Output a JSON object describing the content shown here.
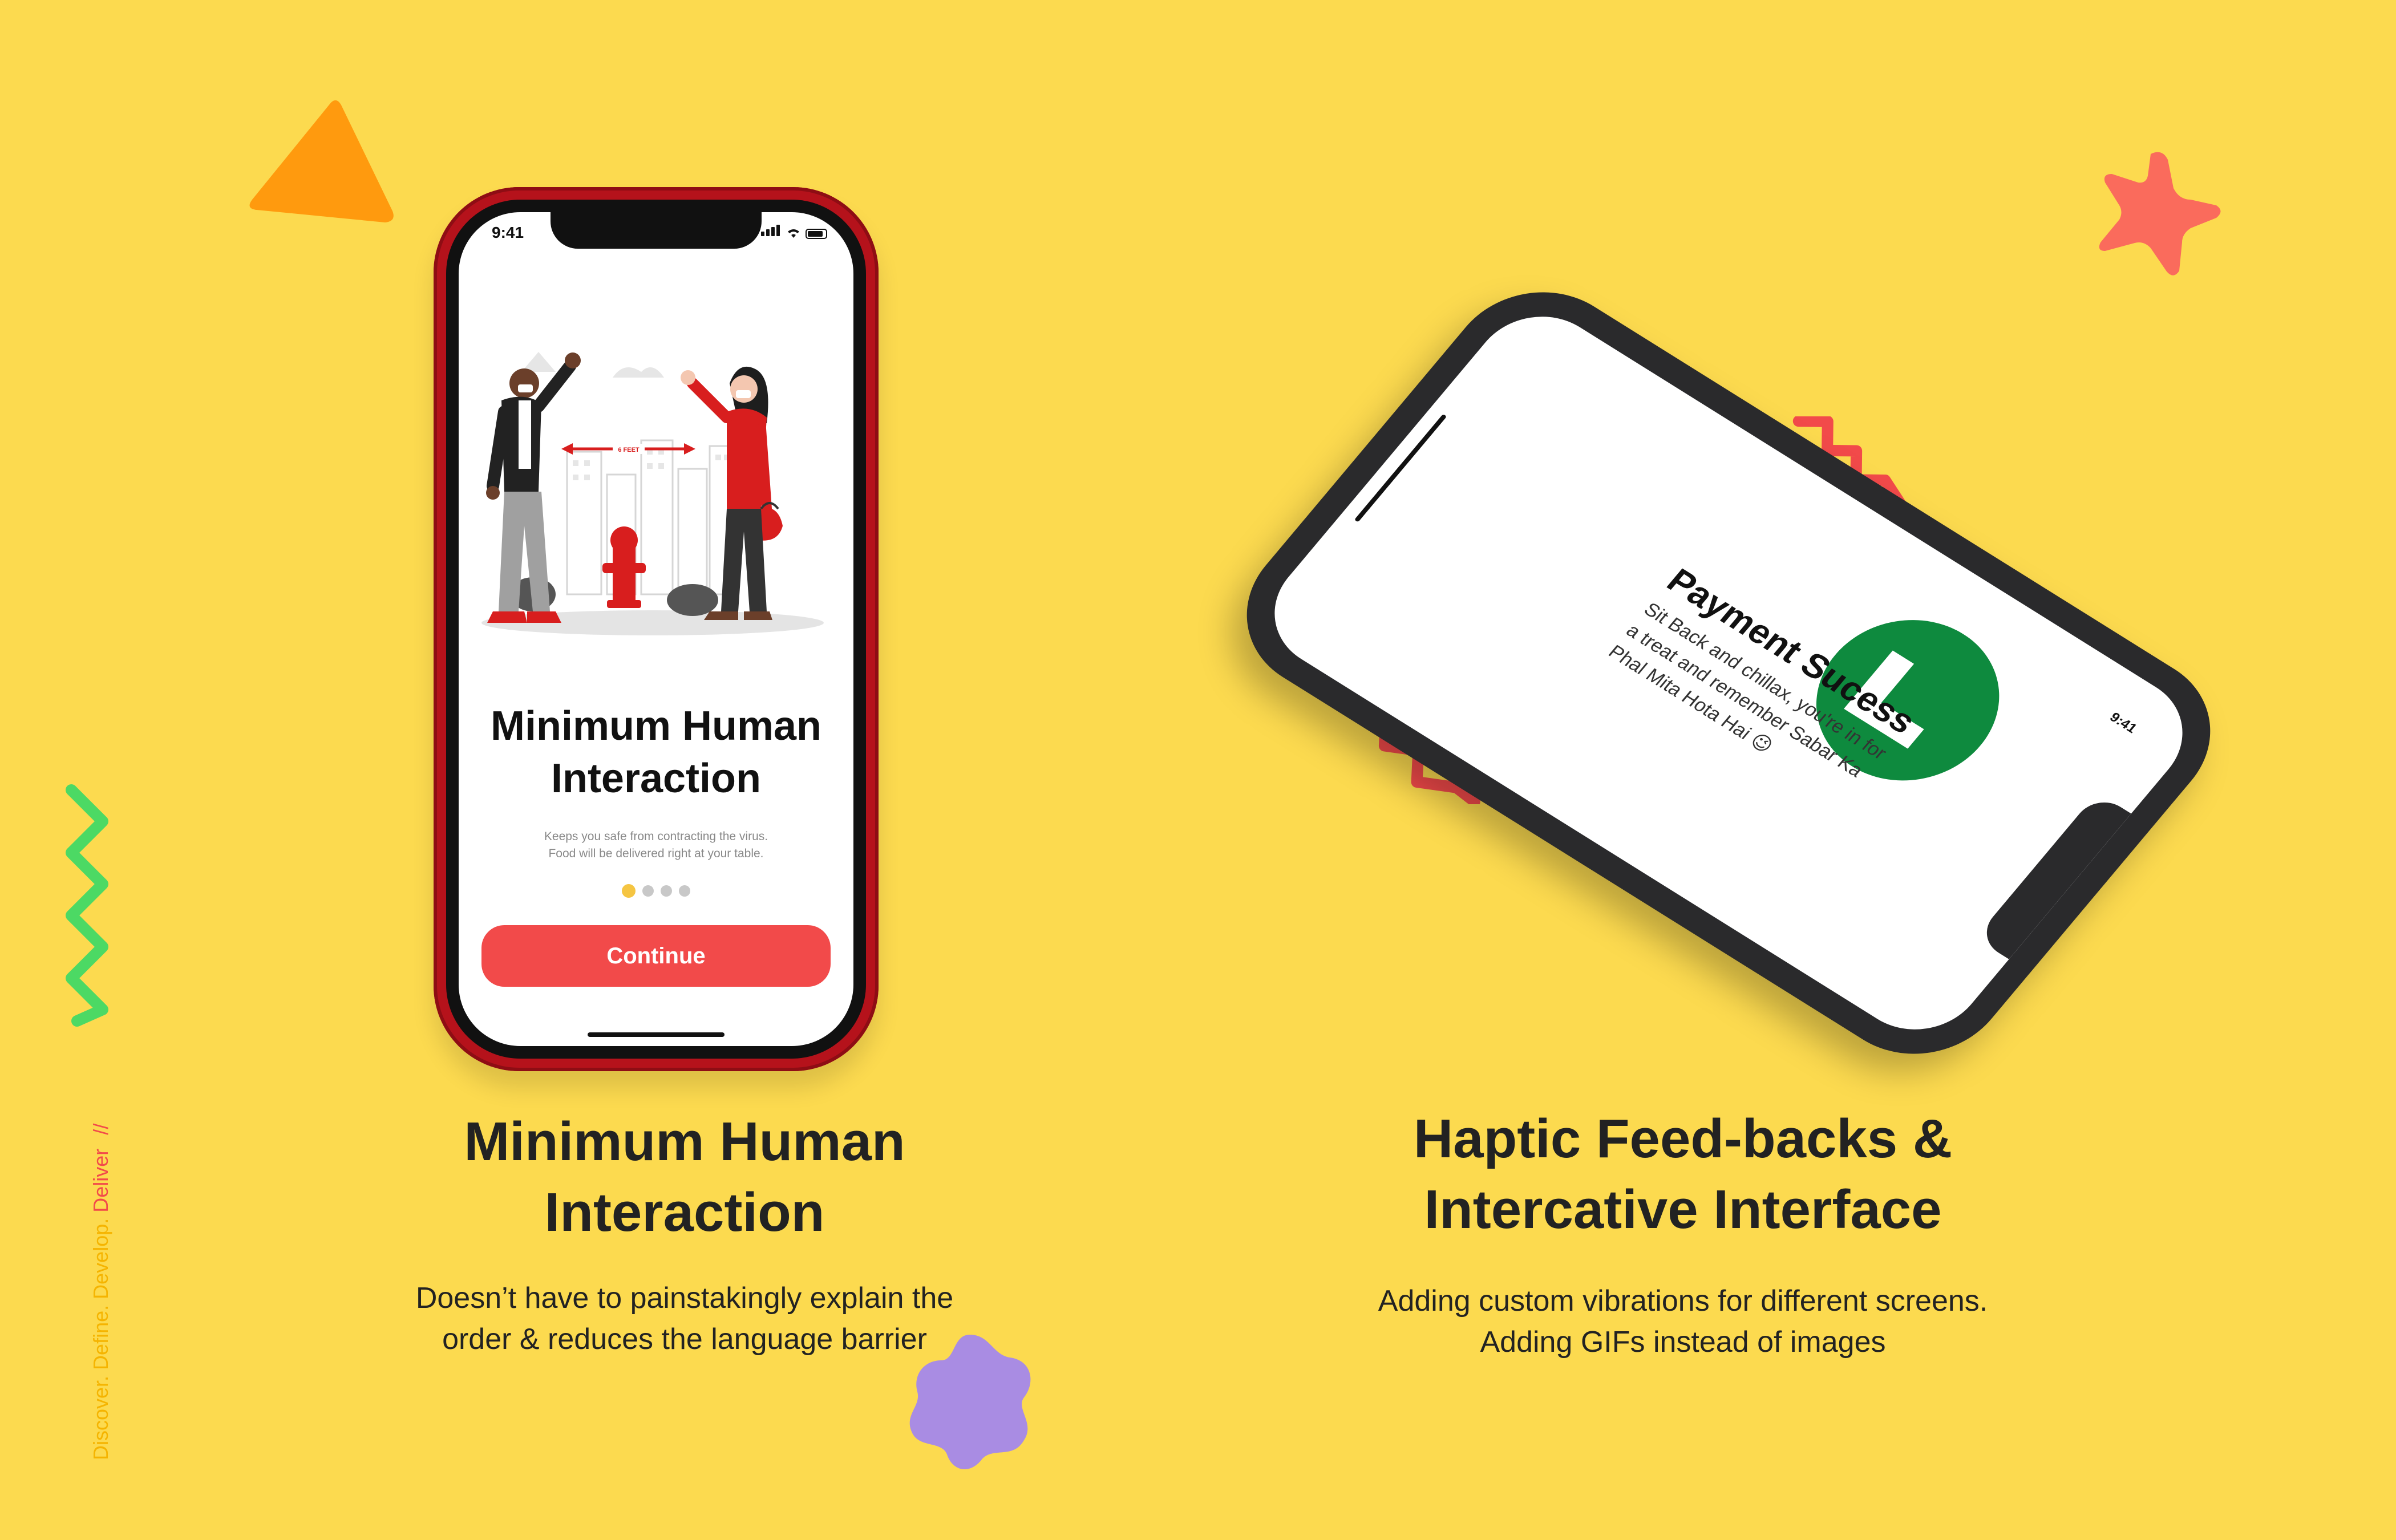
{
  "phone1": {
    "status_time": "9:41",
    "title_line1": "Minimum Human",
    "title_line2": "Interaction",
    "sub_line1": "Keeps you safe from contracting the virus.",
    "sub_line2": "Food will be delivered right at your table.",
    "distance_label": "6 FEET",
    "cta_label": "Continue",
    "dots_count": 4,
    "active_dot": 1
  },
  "caption_left": {
    "title_line1": "Minimum Human",
    "title_line2": "Interaction",
    "body_line1": "Doesn’t have to painstakingly explain the",
    "body_line2": "order & reduces the language barrier"
  },
  "phone2": {
    "status_time": "9:41",
    "title": "Payment Sucess",
    "body_line1": "Sit Back and chillax, you're in for",
    "body_line2": "a treat and remember Sabar Ka",
    "body_line3": "Phal Mita Hota Hai 😉"
  },
  "caption_right": {
    "title_line1": "Haptic Feed-backs &",
    "title_line2": "Intercative Interface",
    "body_line1": "Adding custom vibrations for different screens.",
    "body_line2": "Adding GIFs instead of images"
  },
  "side_tag": {
    "discover": "Discover.",
    "define": "Define.",
    "develop": "Develop.",
    "deliver": "Deliver",
    "slashes": "//"
  },
  "colors": {
    "background": "#FCDA4F",
    "accent_red": "#F24A4A",
    "success_green": "#0E8A3E",
    "phone_red": "#B5121B"
  },
  "icons": [
    "triangle-shape",
    "star-shape",
    "zigzag-shape",
    "flower-shape",
    "check-icon",
    "signal-icon",
    "wifi-icon",
    "battery-icon"
  ]
}
